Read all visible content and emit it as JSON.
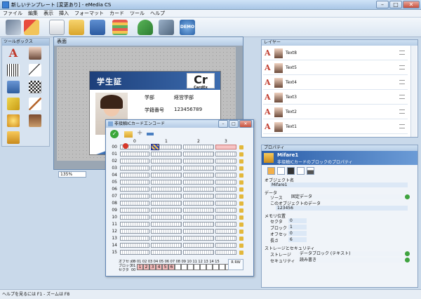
{
  "window": {
    "title": "新しいテンプレート [変更あり] - eMedia CS"
  },
  "menu": [
    "ファイル",
    "編集",
    "表示",
    "挿入",
    "フォーマット",
    "カード",
    "ツール",
    "ヘルプ"
  ],
  "toolbar": {
    "demo_label": "DEMO"
  },
  "toolbox": {
    "title": "ツールボックス"
  },
  "design": {
    "title": "表面",
    "zoom": "135%"
  },
  "card": {
    "title": "学生証",
    "logo": "Cr",
    "logo_sub": "CardEx",
    "dept_label": "学部",
    "dept_value": "経営学部",
    "id_label": "学籍番号",
    "id_value": "123456789"
  },
  "layer": {
    "title": "レイヤー",
    "items": [
      "Text8",
      "Text5",
      "Text4",
      "Text3",
      "Text2",
      "Text1"
    ]
  },
  "properties": {
    "title": "プロパティ",
    "object_name": "Mifare1",
    "object_desc": "非接触ICカードのブロックのプロパティ",
    "obj_name_label": "オブジェクト名",
    "obj_name_value": "Mifare1",
    "data_label": "データ",
    "source_label": "ソース",
    "source_value": "固定データ",
    "objdata_label": "このオブジェクトのデータ",
    "objdata_value": "123456",
    "memory_label": "メモリ位置",
    "sector_label": "セクタ",
    "sector_value": "0",
    "block_label": "ブロック",
    "block_value": "1",
    "offset_label": "オフセット",
    "offset_value": "0",
    "length_label": "長さ",
    "length_value": "6",
    "storage_security_label": "ストレージとセキュリティ",
    "storage_label": "ストレージ",
    "storage_value": "データブロック (テキスト)",
    "security_label": "セキュリティ",
    "security_value": "読み書き"
  },
  "encode": {
    "title": "非接触ICカードエンコード",
    "col_headers": [
      "0",
      "1",
      "2",
      "3"
    ],
    "rows": [
      "00",
      "01",
      "02",
      "03",
      "04",
      "05",
      "06",
      "07",
      "08",
      "09",
      "10",
      "11",
      "12",
      "13",
      "14",
      "15"
    ],
    "offset_label": "オフセット",
    "block_label": "ブロック",
    "sector_label": "セクタ",
    "offset_numbers": "00 01 02 03 04 05 06 07 08 09 10 11 12 13 14 15",
    "block_value": "01",
    "sector_value": "00",
    "hex_values": [
      "1",
      "2",
      "3",
      "4",
      "5",
      "6",
      "",
      "",
      "",
      "",
      "",
      "",
      "",
      "",
      "",
      ""
    ],
    "rw_label": "R RW"
  },
  "status": {
    "text": "ヘルプを見るには F1 - ズームは F8"
  }
}
